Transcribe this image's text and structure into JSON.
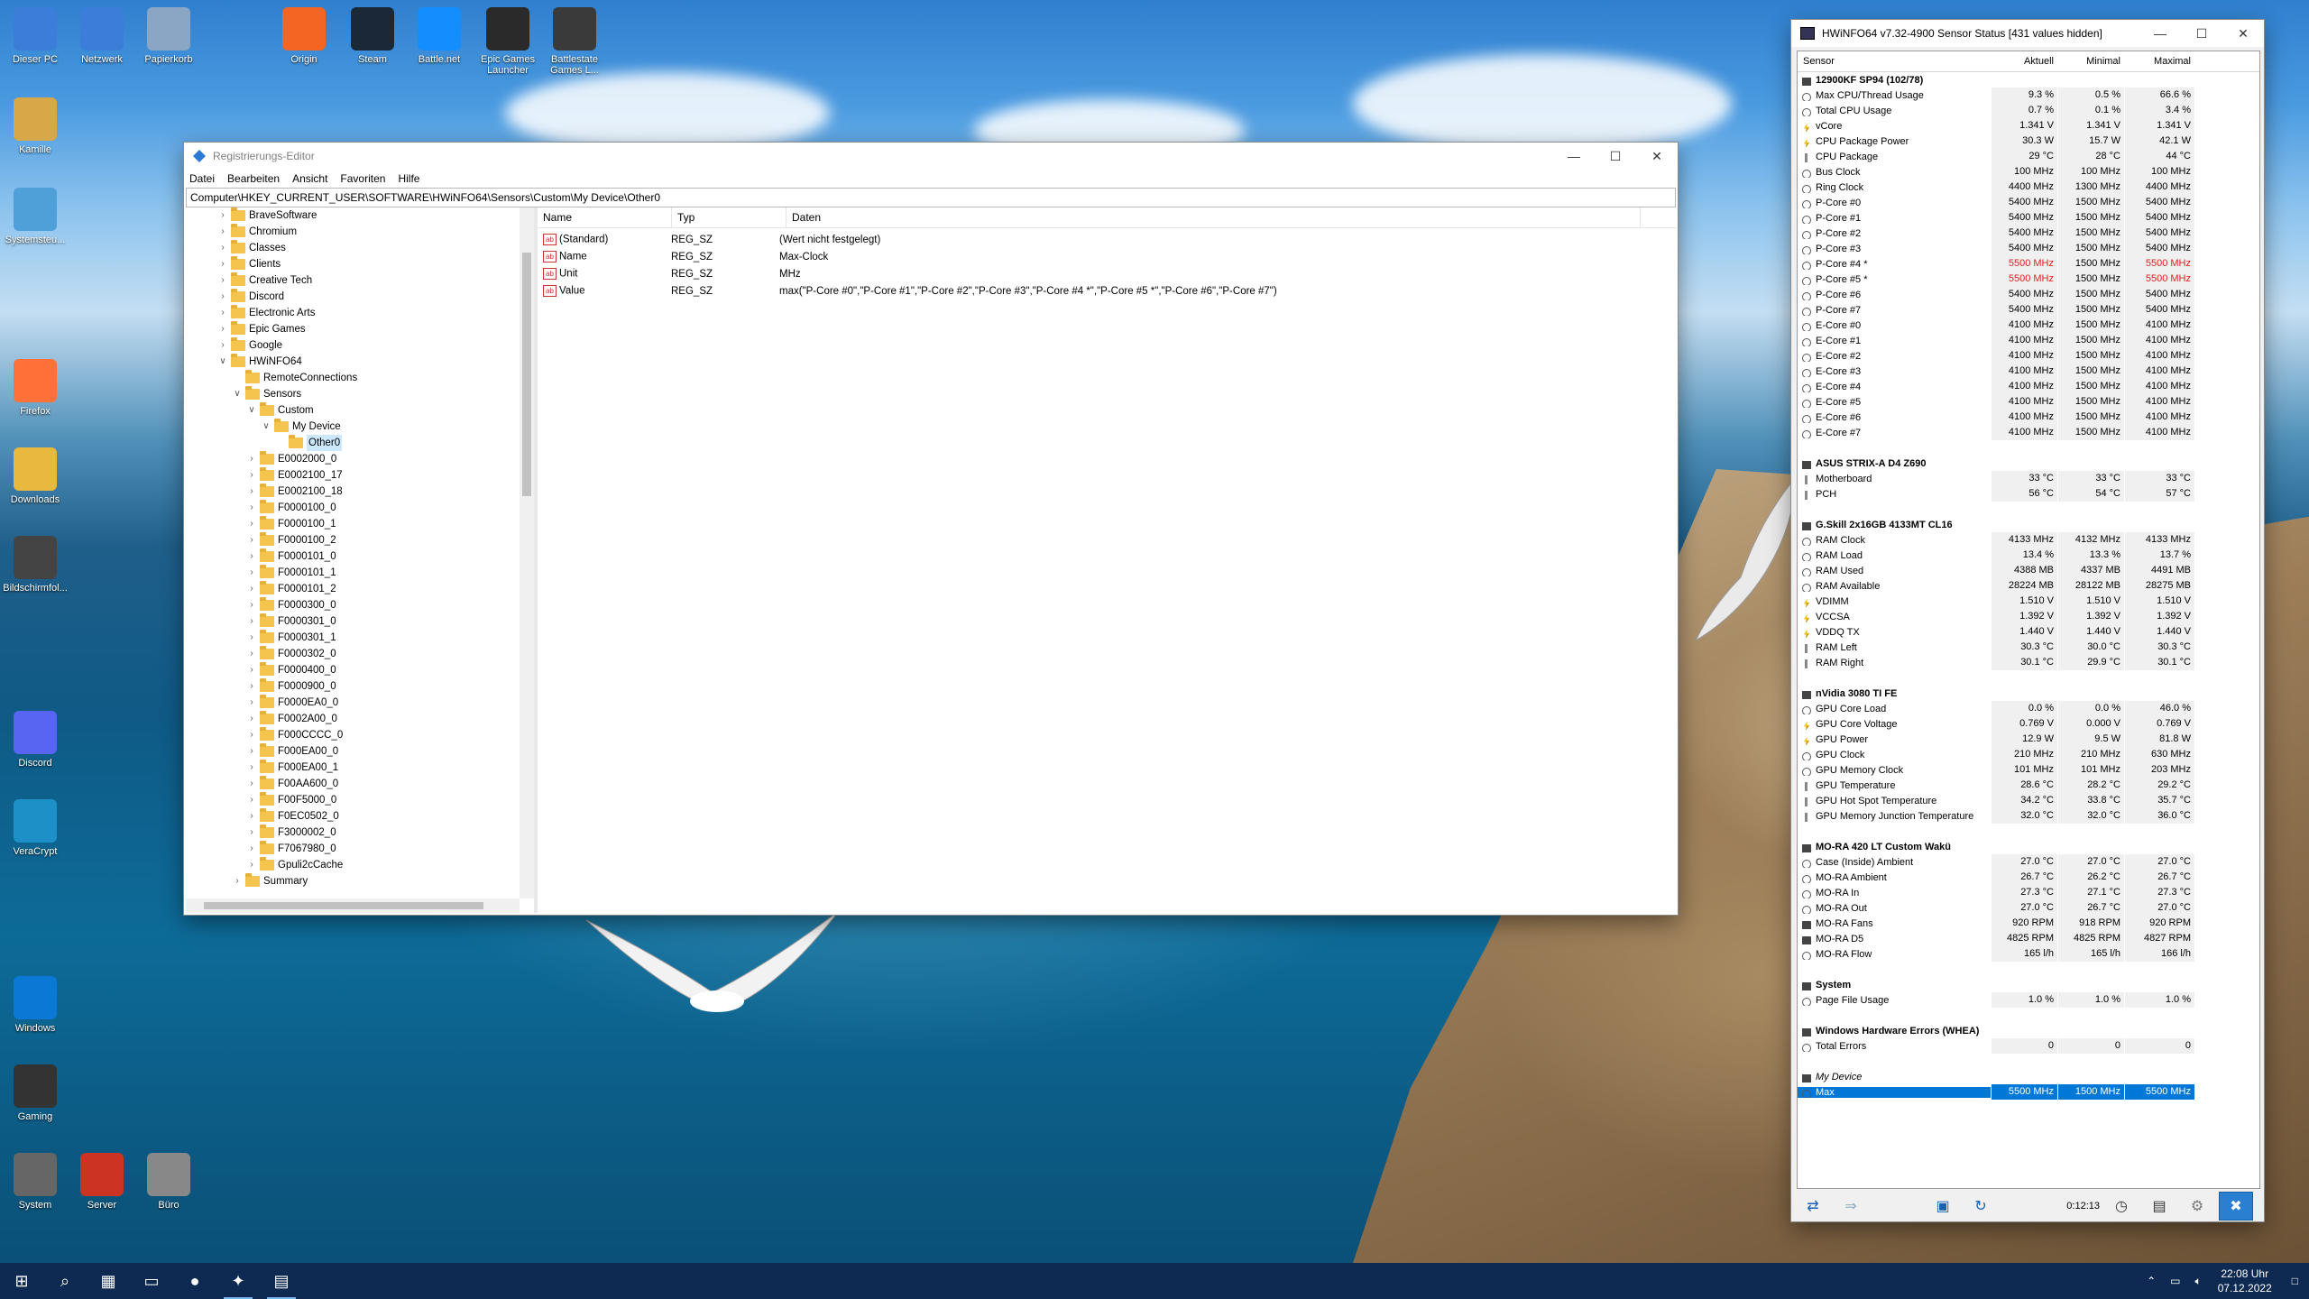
{
  "desktop": {
    "icons": [
      {
        "label": "Dieser PC",
        "icon": "computer-icon",
        "color": "#3b7dd8"
      },
      {
        "label": "Netzwerk",
        "icon": "network-icon",
        "color": "#3b7dd8"
      },
      {
        "label": "Papierkorb",
        "icon": "recycle-bin-icon",
        "color": "#8aa6c4"
      },
      {
        "label": "Origin",
        "icon": "origin-icon",
        "color": "#f26522"
      },
      {
        "label": "Steam",
        "icon": "steam-icon",
        "color": "#1b2838"
      },
      {
        "label": "Battle.net",
        "icon": "battlenet-icon",
        "color": "#148eff"
      },
      {
        "label": "Epic Games Launcher",
        "icon": "epic-games-icon",
        "color": "#2a2a2a"
      },
      {
        "label": "Battlestate Games L...",
        "icon": "battlestate-icon",
        "color": "#3a3a3a"
      },
      {
        "label": "Kamille",
        "icon": "user-folder-icon",
        "color": "#d8a848"
      },
      {
        "label": "Systemsteu...",
        "icon": "control-panel-icon",
        "color": "#4f9fd8"
      },
      {
        "label": "Firefox",
        "icon": "firefox-icon",
        "color": "#ff7139"
      },
      {
        "label": "Downloads",
        "icon": "downloads-icon",
        "color": "#e8b93e"
      },
      {
        "label": "Bildschirmfol...",
        "icon": "screenshot-icon",
        "color": "#444"
      },
      {
        "label": "Discord",
        "icon": "discord-icon",
        "color": "#5865f2"
      },
      {
        "label": "VeraCrypt",
        "icon": "veracrypt-icon",
        "color": "#1e90c8"
      },
      {
        "label": "Windows",
        "icon": "windows-icon",
        "color": "#0a78d4"
      },
      {
        "label": "Gaming",
        "icon": "mouse-icon",
        "color": "#333"
      },
      {
        "label": "System",
        "icon": "gear-icon",
        "color": "#666"
      },
      {
        "label": "Server",
        "icon": "server-icon",
        "color": "#c32"
      },
      {
        "label": "Büro",
        "icon": "notepad-icon",
        "color": "#888"
      }
    ]
  },
  "regedit": {
    "title": "Registrierungs-Editor",
    "menu": [
      "Datei",
      "Bearbeiten",
      "Ansicht",
      "Favoriten",
      "Hilfe"
    ],
    "address": "Computer\\HKEY_CURRENT_USER\\SOFTWARE\\HWiNFO64\\Sensors\\Custom\\My Device\\Other0",
    "tree": [
      {
        "label": "BraveSoftware",
        "level": 0,
        "exp": ">"
      },
      {
        "label": "Chromium",
        "level": 0,
        "exp": ">"
      },
      {
        "label": "Classes",
        "level": 0,
        "exp": ">"
      },
      {
        "label": "Clients",
        "level": 0,
        "exp": ">"
      },
      {
        "label": "Creative Tech",
        "level": 0,
        "exp": ">"
      },
      {
        "label": "Discord",
        "level": 0,
        "exp": ">"
      },
      {
        "label": "Electronic Arts",
        "level": 0,
        "exp": ">"
      },
      {
        "label": "Epic Games",
        "level": 0,
        "exp": ">"
      },
      {
        "label": "Google",
        "level": 0,
        "exp": ">"
      },
      {
        "label": "HWiNFO64",
        "level": 0,
        "exp": "v"
      },
      {
        "label": "RemoteConnections",
        "level": 1,
        "exp": ""
      },
      {
        "label": "Sensors",
        "level": 1,
        "exp": "v"
      },
      {
        "label": "Custom",
        "level": 2,
        "exp": "v"
      },
      {
        "label": "My Device",
        "level": 3,
        "exp": "v"
      },
      {
        "label": "Other0",
        "level": 4,
        "exp": "",
        "selected": true
      },
      {
        "label": "E0002000_0",
        "level": 2,
        "exp": ">"
      },
      {
        "label": "E0002100_17",
        "level": 2,
        "exp": ">"
      },
      {
        "label": "E0002100_18",
        "level": 2,
        "exp": ">"
      },
      {
        "label": "F0000100_0",
        "level": 2,
        "exp": ">"
      },
      {
        "label": "F0000100_1",
        "level": 2,
        "exp": ">"
      },
      {
        "label": "F0000100_2",
        "level": 2,
        "exp": ">"
      },
      {
        "label": "F0000101_0",
        "level": 2,
        "exp": ">"
      },
      {
        "label": "F0000101_1",
        "level": 2,
        "exp": ">"
      },
      {
        "label": "F0000101_2",
        "level": 2,
        "exp": ">"
      },
      {
        "label": "F0000300_0",
        "level": 2,
        "exp": ">"
      },
      {
        "label": "F0000301_0",
        "level": 2,
        "exp": ">"
      },
      {
        "label": "F0000301_1",
        "level": 2,
        "exp": ">"
      },
      {
        "label": "F0000302_0",
        "level": 2,
        "exp": ">"
      },
      {
        "label": "F0000400_0",
        "level": 2,
        "exp": ">"
      },
      {
        "label": "F0000900_0",
        "level": 2,
        "exp": ">"
      },
      {
        "label": "F0000EA0_0",
        "level": 2,
        "exp": ">"
      },
      {
        "label": "F0002A00_0",
        "level": 2,
        "exp": ">"
      },
      {
        "label": "F000CCCC_0",
        "level": 2,
        "exp": ">"
      },
      {
        "label": "F000EA00_0",
        "level": 2,
        "exp": ">"
      },
      {
        "label": "F000EA00_1",
        "level": 2,
        "exp": ">"
      },
      {
        "label": "F00AA600_0",
        "level": 2,
        "exp": ">"
      },
      {
        "label": "F00F5000_0",
        "level": 2,
        "exp": ">"
      },
      {
        "label": "F0EC0502_0",
        "level": 2,
        "exp": ">"
      },
      {
        "label": "F3000002_0",
        "level": 2,
        "exp": ">"
      },
      {
        "label": "F7067980_0",
        "level": 2,
        "exp": ">"
      },
      {
        "label": "Gpuli2cCache",
        "level": 2,
        "exp": ">"
      },
      {
        "label": "Summary",
        "level": 1,
        "exp": ">"
      }
    ],
    "columns": [
      "Name",
      "Typ",
      "Daten"
    ],
    "values": [
      {
        "name": "(Standard)",
        "type": "REG_SZ",
        "data": "(Wert nicht festgelegt)"
      },
      {
        "name": "Name",
        "type": "REG_SZ",
        "data": "Max-Clock"
      },
      {
        "name": "Unit",
        "type": "REG_SZ",
        "data": "MHz"
      },
      {
        "name": "Value",
        "type": "REG_SZ",
        "data": "max(\"P-Core #0\",\"P-Core #1\",\"P-Core #2\",\"P-Core #3\",\"P-Core #4 *\",\"P-Core #5 *\",\"P-Core #6\",\"P-Core #7\")"
      }
    ]
  },
  "hwinfo": {
    "title": "HWiNFO64 v7.32-4900 Sensor Status [431 values hidden]",
    "columns": [
      "Sensor",
      "Aktuell",
      "Minimal",
      "Maximal"
    ],
    "timer": "0:12:13",
    "rows": [
      {
        "kind": "group",
        "name": "12900KF SP94 (102/78)"
      },
      {
        "kind": "row",
        "icon": "circle",
        "name": "Max CPU/Thread Usage",
        "cur": "9.3 %",
        "min": "0.5 %",
        "max": "66.6 %"
      },
      {
        "kind": "row",
        "icon": "circle",
        "name": "Total CPU Usage",
        "cur": "0.7 %",
        "min": "0.1 %",
        "max": "3.4 %"
      },
      {
        "kind": "row",
        "icon": "bolt",
        "name": "vCore",
        "cur": "1.341 V",
        "min": "1.341 V",
        "max": "1.341 V"
      },
      {
        "kind": "row",
        "icon": "bolt",
        "name": "CPU Package Power",
        "cur": "30.3 W",
        "min": "15.7 W",
        "max": "42.1 W"
      },
      {
        "kind": "row",
        "icon": "therm",
        "name": "CPU Package",
        "cur": "29 °C",
        "min": "28 °C",
        "max": "44 °C"
      },
      {
        "kind": "row",
        "icon": "circle",
        "name": "Bus Clock",
        "cur": "100 MHz",
        "min": "100 MHz",
        "max": "100 MHz"
      },
      {
        "kind": "row",
        "icon": "circle",
        "name": "Ring Clock",
        "cur": "4400 MHz",
        "min": "1300 MHz",
        "max": "4400 MHz"
      },
      {
        "kind": "row",
        "icon": "circle",
        "name": "P-Core #0",
        "cur": "5400 MHz",
        "min": "1500 MHz",
        "max": "5400 MHz"
      },
      {
        "kind": "row",
        "icon": "circle",
        "name": "P-Core #1",
        "cur": "5400 MHz",
        "min": "1500 MHz",
        "max": "5400 MHz"
      },
      {
        "kind": "row",
        "icon": "circle",
        "name": "P-Core #2",
        "cur": "5400 MHz",
        "min": "1500 MHz",
        "max": "5400 MHz"
      },
      {
        "kind": "row",
        "icon": "circle",
        "name": "P-Core #3",
        "cur": "5400 MHz",
        "min": "1500 MHz",
        "max": "5400 MHz"
      },
      {
        "kind": "row",
        "icon": "circle",
        "name": "P-Core #4 *",
        "cur": "5500 MHz",
        "min": "1500 MHz",
        "max": "5500 MHz",
        "red": true
      },
      {
        "kind": "row",
        "icon": "circle",
        "name": "P-Core #5 *",
        "cur": "5500 MHz",
        "min": "1500 MHz",
        "max": "5500 MHz",
        "red": true
      },
      {
        "kind": "row",
        "icon": "circle",
        "name": "P-Core #6",
        "cur": "5400 MHz",
        "min": "1500 MHz",
        "max": "5400 MHz"
      },
      {
        "kind": "row",
        "icon": "circle",
        "name": "P-Core #7",
        "cur": "5400 MHz",
        "min": "1500 MHz",
        "max": "5400 MHz"
      },
      {
        "kind": "row",
        "icon": "circle",
        "name": "E-Core #0",
        "cur": "4100 MHz",
        "min": "1500 MHz",
        "max": "4100 MHz"
      },
      {
        "kind": "row",
        "icon": "circle",
        "name": "E-Core #1",
        "cur": "4100 MHz",
        "min": "1500 MHz",
        "max": "4100 MHz"
      },
      {
        "kind": "row",
        "icon": "circle",
        "name": "E-Core #2",
        "cur": "4100 MHz",
        "min": "1500 MHz",
        "max": "4100 MHz"
      },
      {
        "kind": "row",
        "icon": "circle",
        "name": "E-Core #3",
        "cur": "4100 MHz",
        "min": "1500 MHz",
        "max": "4100 MHz"
      },
      {
        "kind": "row",
        "icon": "circle",
        "name": "E-Core #4",
        "cur": "4100 MHz",
        "min": "1500 MHz",
        "max": "4100 MHz"
      },
      {
        "kind": "row",
        "icon": "circle",
        "name": "E-Core #5",
        "cur": "4100 MHz",
        "min": "1500 MHz",
        "max": "4100 MHz"
      },
      {
        "kind": "row",
        "icon": "circle",
        "name": "E-Core #6",
        "cur": "4100 MHz",
        "min": "1500 MHz",
        "max": "4100 MHz"
      },
      {
        "kind": "row",
        "icon": "circle",
        "name": "E-Core #7",
        "cur": "4100 MHz",
        "min": "1500 MHz",
        "max": "4100 MHz"
      },
      {
        "kind": "spacer"
      },
      {
        "kind": "group",
        "name": "ASUS STRIX-A D4 Z690"
      },
      {
        "kind": "row",
        "icon": "therm",
        "name": "Motherboard",
        "cur": "33 °C",
        "min": "33 °C",
        "max": "33 °C"
      },
      {
        "kind": "row",
        "icon": "therm",
        "name": "PCH",
        "cur": "56 °C",
        "min": "54 °C",
        "max": "57 °C"
      },
      {
        "kind": "spacer"
      },
      {
        "kind": "group",
        "name": "G.Skill 2x16GB 4133MT CL16"
      },
      {
        "kind": "row",
        "icon": "circle",
        "name": "RAM Clock",
        "cur": "4133 MHz",
        "min": "4132 MHz",
        "max": "4133 MHz"
      },
      {
        "kind": "row",
        "icon": "circle",
        "name": "RAM Load",
        "cur": "13.4 %",
        "min": "13.3 %",
        "max": "13.7 %"
      },
      {
        "kind": "row",
        "icon": "circle",
        "name": "RAM Used",
        "cur": "4388 MB",
        "min": "4337 MB",
        "max": "4491 MB"
      },
      {
        "kind": "row",
        "icon": "circle",
        "name": "RAM Available",
        "cur": "28224 MB",
        "min": "28122 MB",
        "max": "28275 MB"
      },
      {
        "kind": "row",
        "icon": "bolt",
        "name": "VDIMM",
        "cur": "1.510 V",
        "min": "1.510 V",
        "max": "1.510 V"
      },
      {
        "kind": "row",
        "icon": "bolt",
        "name": "VCCSA",
        "cur": "1.392 V",
        "min": "1.392 V",
        "max": "1.392 V"
      },
      {
        "kind": "row",
        "icon": "bolt",
        "name": "VDDQ TX",
        "cur": "1.440 V",
        "min": "1.440 V",
        "max": "1.440 V"
      },
      {
        "kind": "row",
        "icon": "therm",
        "name": "RAM Left",
        "cur": "30.3 °C",
        "min": "30.0 °C",
        "max": "30.3 °C"
      },
      {
        "kind": "row",
        "icon": "therm",
        "name": "RAM Right",
        "cur": "30.1 °C",
        "min": "29.9 °C",
        "max": "30.1 °C"
      },
      {
        "kind": "spacer"
      },
      {
        "kind": "group",
        "name": "nVidia 3080 TI FE"
      },
      {
        "kind": "row",
        "icon": "circle",
        "name": "GPU Core Load",
        "cur": "0.0 %",
        "min": "0.0 %",
        "max": "46.0 %"
      },
      {
        "kind": "row",
        "icon": "bolt",
        "name": "GPU Core Voltage",
        "cur": "0.769 V",
        "min": "0.000 V",
        "max": "0.769 V"
      },
      {
        "kind": "row",
        "icon": "bolt",
        "name": "GPU Power",
        "cur": "12.9 W",
        "min": "9.5 W",
        "max": "81.8 W"
      },
      {
        "kind": "row",
        "icon": "circle",
        "name": "GPU Clock",
        "cur": "210 MHz",
        "min": "210 MHz",
        "max": "630 MHz"
      },
      {
        "kind": "row",
        "icon": "circle",
        "name": "GPU Memory Clock",
        "cur": "101 MHz",
        "min": "101 MHz",
        "max": "203 MHz"
      },
      {
        "kind": "row",
        "icon": "therm",
        "name": "GPU Temperature",
        "cur": "28.6 °C",
        "min": "28.2 °C",
        "max": "29.2 °C"
      },
      {
        "kind": "row",
        "icon": "therm",
        "name": "GPU Hot Spot Temperature",
        "cur": "34.2 °C",
        "min": "33.8 °C",
        "max": "35.7 °C"
      },
      {
        "kind": "row",
        "icon": "therm",
        "name": "GPU Memory Junction Temperature",
        "cur": "32.0 °C",
        "min": "32.0 °C",
        "max": "36.0 °C"
      },
      {
        "kind": "spacer"
      },
      {
        "kind": "group",
        "name": "MO-RA 420 LT Custom Wakü"
      },
      {
        "kind": "row",
        "icon": "circle",
        "name": "Case (Inside) Ambient",
        "cur": "27.0 °C",
        "min": "27.0 °C",
        "max": "27.0 °C"
      },
      {
        "kind": "row",
        "icon": "circle",
        "name": "MO-RA Ambient",
        "cur": "26.7 °C",
        "min": "26.2 °C",
        "max": "26.7 °C"
      },
      {
        "kind": "row",
        "icon": "circle",
        "name": "MO-RA In",
        "cur": "27.3 °C",
        "min": "27.1 °C",
        "max": "27.3 °C"
      },
      {
        "kind": "row",
        "icon": "circle",
        "name": "MO-RA Out",
        "cur": "27.0 °C",
        "min": "26.7 °C",
        "max": "27.0 °C"
      },
      {
        "kind": "row",
        "icon": "chip",
        "name": "MO-RA Fans",
        "cur": "920 RPM",
        "min": "918 RPM",
        "max": "920 RPM"
      },
      {
        "kind": "row",
        "icon": "chip",
        "name": "MO-RA D5",
        "cur": "4825 RPM",
        "min": "4825 RPM",
        "max": "4827 RPM"
      },
      {
        "kind": "row",
        "icon": "circle",
        "name": "MO-RA Flow",
        "cur": "165 l/h",
        "min": "165 l/h",
        "max": "166 l/h"
      },
      {
        "kind": "spacer"
      },
      {
        "kind": "group",
        "name": "System"
      },
      {
        "kind": "row",
        "icon": "circle",
        "name": "Page File Usage",
        "cur": "1.0 %",
        "min": "1.0 %",
        "max": "1.0 %"
      },
      {
        "kind": "spacer"
      },
      {
        "kind": "group",
        "name": "Windows Hardware Errors (WHEA)"
      },
      {
        "kind": "row",
        "icon": "circle",
        "name": "Total Errors",
        "cur": "0",
        "min": "0",
        "max": "0"
      },
      {
        "kind": "spacer"
      },
      {
        "kind": "group",
        "name": "My Device",
        "italic": true
      },
      {
        "kind": "row",
        "icon": "circle",
        "name": "Max",
        "cur": "5500 MHz",
        "min": "1500 MHz",
        "max": "5500 MHz",
        "selected": true
      }
    ]
  },
  "taskbar": {
    "apps": [
      {
        "icon": "start-icon",
        "glyph": "⊞"
      },
      {
        "icon": "search-icon",
        "glyph": "⌕"
      },
      {
        "icon": "calculator-icon",
        "glyph": "▦"
      },
      {
        "icon": "file-explorer-icon",
        "glyph": "▭"
      },
      {
        "icon": "firefox-icon",
        "glyph": "●"
      },
      {
        "icon": "regedit-icon",
        "glyph": "✦",
        "active": true
      },
      {
        "icon": "hwinfo-icon",
        "glyph": "▤",
        "active": true
      }
    ],
    "time": "22:08 Uhr",
    "date": "07.12.2022"
  },
  "colors": {
    "accent": "#0078d7",
    "alert": "#e02020",
    "taskbar": "#0e2a52"
  }
}
